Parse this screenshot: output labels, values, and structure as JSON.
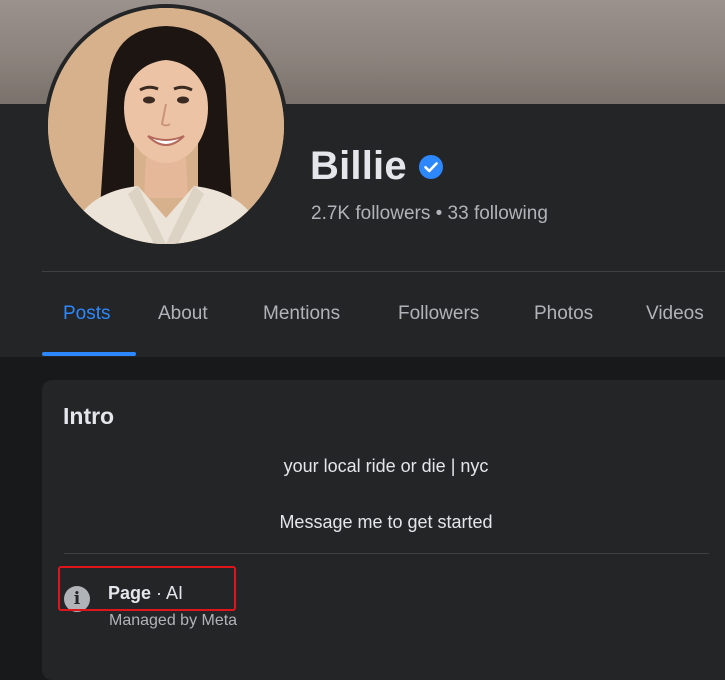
{
  "profile": {
    "name": "Billie",
    "stats": "2.7K followers • 33 following",
    "verified": true
  },
  "tabs": [
    {
      "label": "Posts",
      "active": true
    },
    {
      "label": "About",
      "active": false
    },
    {
      "label": "Mentions",
      "active": false
    },
    {
      "label": "Followers",
      "active": false
    },
    {
      "label": "Photos",
      "active": false
    },
    {
      "label": "Videos",
      "active": false
    }
  ],
  "intro": {
    "title": "Intro",
    "bio_line1": "your local ride or die | nyc",
    "bio_line2": "Message me to get started",
    "page_label": "Page",
    "page_separator": " · ",
    "page_category": "AI",
    "managed_by": "Managed by Meta"
  },
  "colors": {
    "accent": "#2d88ff",
    "highlight_box": "#e0151b",
    "background": "#18191a",
    "card": "#242526"
  }
}
